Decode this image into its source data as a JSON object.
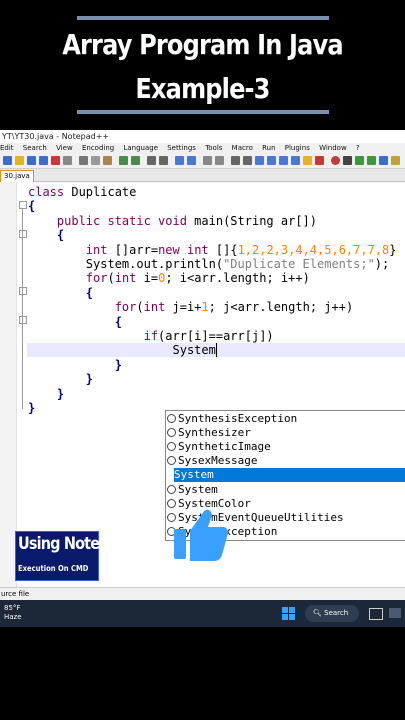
{
  "video": {
    "title_line1": "Array Program In Java",
    "title_line2": "Example-3"
  },
  "window": {
    "title": "YT\\YT30.java - Notepad++"
  },
  "menu": [
    "Edit",
    "Search",
    "View",
    "Encoding",
    "Language",
    "Settings",
    "Tools",
    "Macro",
    "Run",
    "Plugins",
    "Window",
    "?"
  ],
  "tab": {
    "label": "30.java"
  },
  "code": {
    "l1_kw": "class",
    "l1_rest": " Duplicate",
    "l2": "{",
    "l3_kw": "public static void",
    "l3_rest": " main(String ar[])",
    "l4": "{",
    "l5_a": "int",
    "l5_b": " []arr=",
    "l5_c": "new",
    "l5_d": " int",
    "l5_e": " []{",
    "l5_nums": "1,2,2,3,4,4,5,6,7,7,8",
    "l5_end": "}",
    "l6_a": "System.out.println(",
    "l6_str": "\"Duplicate Elements;\"",
    "l6_end": ");",
    "l7_kw": "for",
    "l7_a": "(",
    "l7_int": "int",
    "l7_b": " i=",
    "l7_zero": "0",
    "l7_c": "; i<arr.length; i++)",
    "l8": "{",
    "l9_kw": "for",
    "l9_a": "(",
    "l9_int": "int",
    "l9_b": " j=i+",
    "l9_one": "1",
    "l9_c": "; j<arr.length; j++)",
    "l10": "{",
    "l11_kw": "if",
    "l11_rest": "(arr[i]==arr[j])",
    "l12": "System",
    "l13": "}",
    "l14": "}",
    "l15": "}",
    "l16": "}"
  },
  "autocomplete": {
    "items": [
      "SynthesisException",
      "Synthesizer",
      "SyntheticImage",
      "SysexMessage",
      "System",
      "System",
      "SystemColor",
      "SystemEventQueueUtilities",
      "SystemException"
    ],
    "selected_index": 4
  },
  "status": {
    "left": "urce file"
  },
  "taskbar": {
    "temp": "85°F",
    "weather": "Haze",
    "search": "Search"
  },
  "promo": {
    "title": "Using Notepad++",
    "subtitle": "Execution On CMD"
  },
  "colors": {
    "accent": "#0078d7",
    "thumb": "#3aa0ff",
    "promo_bg": "#0a1a6a"
  }
}
